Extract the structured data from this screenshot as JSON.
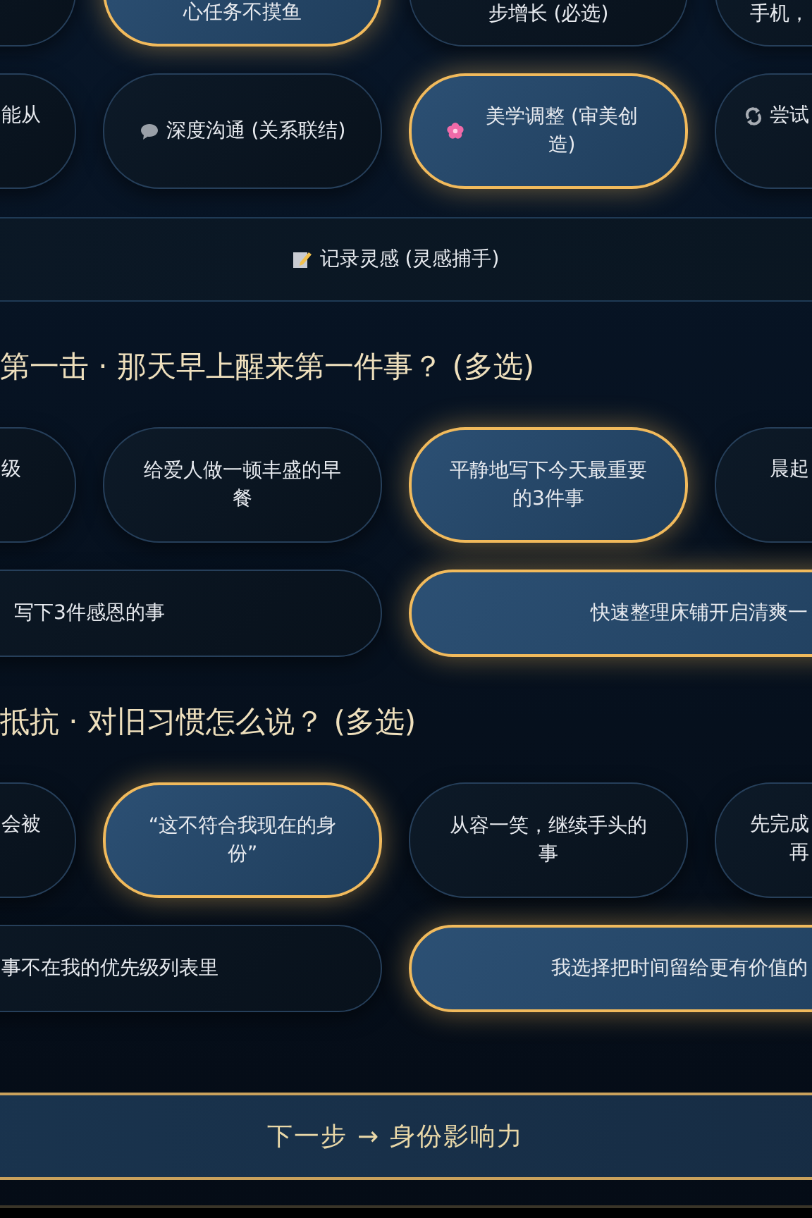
{
  "blocks": [
    {
      "kind": "quad",
      "options": [
        {
          "kind": "text",
          "selected": false
        },
        {
          "kind": "text",
          "label": "心任务不摸鱼",
          "selected": true,
          "clipped": false
        },
        {
          "kind": "text",
          "label": "步增长 (必选)",
          "selected": false,
          "clipped": false
        },
        {
          "kind": "text",
          "label": "手机，",
          "selected": false,
          "clipped": true
        }
      ]
    },
    {
      "kind": "quad",
      "options": [
        {
          "kind": "text",
          "label": "能从",
          "selected": false,
          "clipped": true
        },
        {
          "kind": "bubble",
          "label": "深度沟通 (关系联结)",
          "selected": false,
          "clipped": false
        },
        {
          "kind": "flower",
          "label": "美学调整 (审美创造)",
          "selected": true,
          "clipped": false
        },
        {
          "kind": "cycle",
          "label": "尝试",
          "selected": false,
          "clipped": true
        }
      ]
    },
    {
      "kind": "bar",
      "options": [
        {
          "kind": "memo",
          "label": "记录灵感 (灵感捕手)",
          "selected": false,
          "clipped": false
        }
      ]
    },
    {
      "kind": "heading",
      "text": "第一击 · 那天早上醒来第一件事？ (多选)"
    },
    {
      "kind": "quad",
      "options": [
        {
          "kind": "text",
          "label": "级",
          "selected": false,
          "clipped": true
        },
        {
          "kind": "text",
          "label": "给爱人做一顿丰盛的早餐",
          "selected": false,
          "clipped": false
        },
        {
          "kind": "text",
          "label": "平静地写下今天最重要的3件事",
          "selected": true,
          "clipped": false
        },
        {
          "kind": "text",
          "label": "晨起",
          "selected": false,
          "clipped": true
        }
      ]
    },
    {
      "kind": "pair",
      "options": [
        {
          "kind": "text",
          "label": "写下3件感恩的事",
          "selected": false,
          "clipped": false
        },
        {
          "kind": "text",
          "label": "快速整理床铺开启清爽一",
          "selected": true,
          "clipped": true
        }
      ]
    },
    {
      "kind": "heading",
      "text": "抵抗 · 对旧习惯怎么说？ (多选)"
    },
    {
      "kind": "quad",
      "options": [
        {
          "kind": "text",
          "label": "会被",
          "selected": false,
          "clipped": true
        },
        {
          "kind": "text",
          "label": "“这不符合我现在的身份”",
          "selected": true,
          "clipped": false
        },
        {
          "kind": "text",
          "label": "从容一笑，继续手头的事",
          "selected": false,
          "clipped": false
        },
        {
          "kind": "text",
          "lines": [
            "先完成",
            "再"
          ],
          "selected": false,
          "clipped": true
        }
      ]
    },
    {
      "kind": "pair",
      "options": [
        {
          "kind": "text",
          "label": "事不在我的优先级列表里",
          "selected": false,
          "clipped": true
        },
        {
          "kind": "text",
          "label": "我选择把时间留给更有价值的",
          "selected": true,
          "clipped": true
        }
      ]
    },
    {
      "kind": "next",
      "text": "下一步 → 身份影响力"
    }
  ]
}
